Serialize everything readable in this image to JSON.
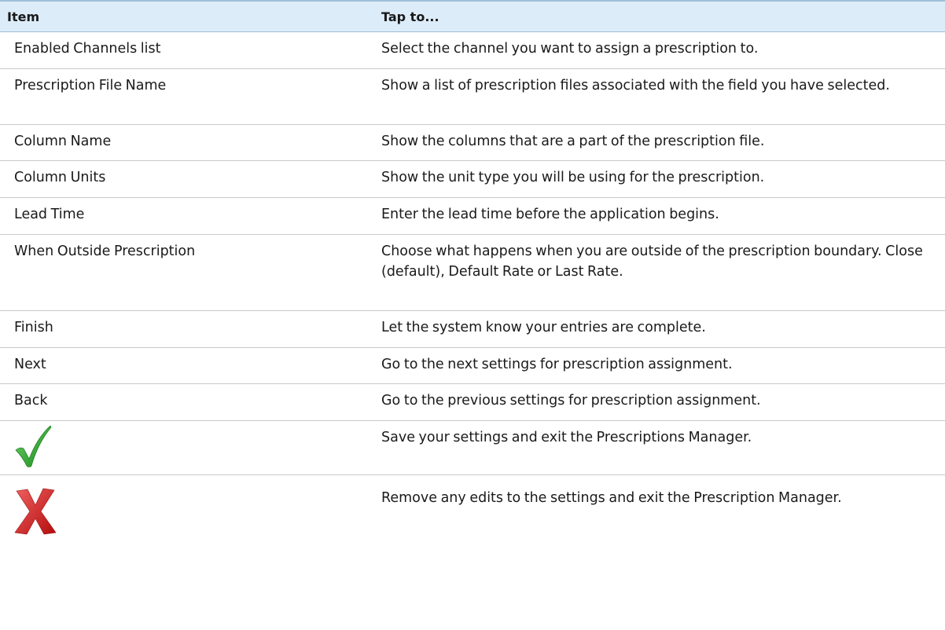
{
  "table": {
    "header": {
      "item": "Item",
      "tap_to": "Tap to..."
    },
    "rows": [
      {
        "item": "Enabled Channels list",
        "description": "Select the channel you want to assign a prescription to."
      },
      {
        "item": "Prescription File Name",
        "description": "Show a list of prescription files associated with the field you have selected."
      },
      {
        "item": "Column Name",
        "description": "Show the columns that are a part of the prescription file."
      },
      {
        "item": "Column Units",
        "description": "Show the unit type you will be using for the prescription."
      },
      {
        "item": "Lead Time",
        "description": "Enter the lead time before the application begins."
      },
      {
        "item": "When Outside Prescription",
        "description": "Choose what happens when you are outside of the prescription boundary. Close (default), Default Rate or Last Rate."
      },
      {
        "item": "Finish",
        "description": "Let the system know your entries are complete."
      },
      {
        "item": "Next",
        "description": "Go to the next settings for prescription assignment."
      },
      {
        "item": "Back",
        "description": "Go to the previous settings for prescription assignment."
      }
    ],
    "icon_rows": [
      {
        "icon": "checkmark-icon",
        "color": "#2e9e2e",
        "description": "Save your settings and exit the Prescriptions Manager."
      },
      {
        "icon": "red-x-icon",
        "color": "#d42020",
        "description": "Remove any edits to the settings and exit the Prescription Manager."
      }
    ]
  }
}
